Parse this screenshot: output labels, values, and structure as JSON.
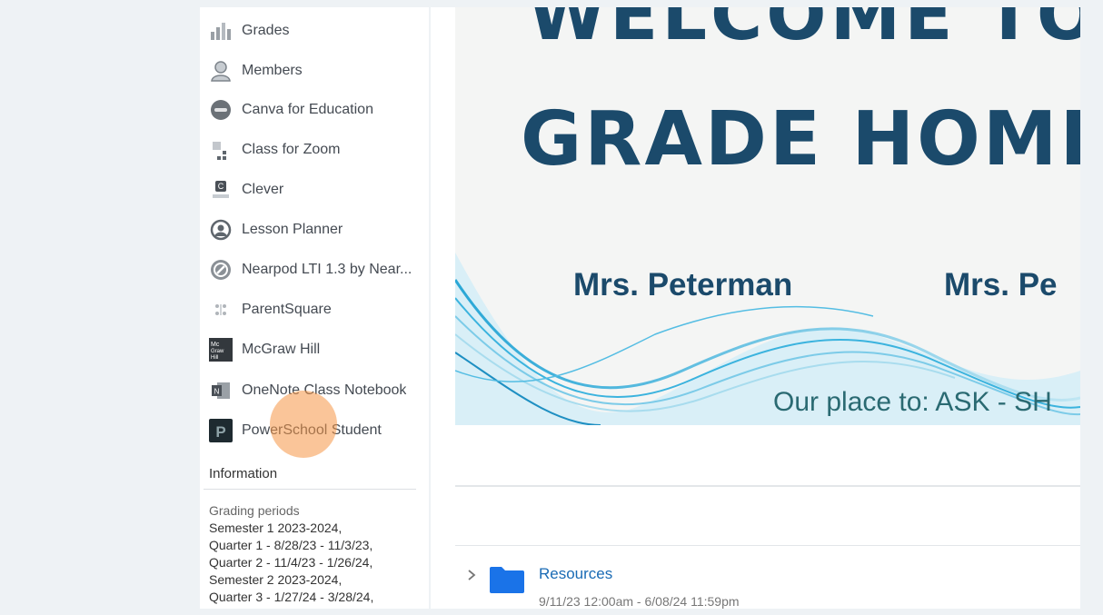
{
  "sidebar": {
    "items": [
      {
        "label": "Grades",
        "icon": "grades-icon"
      },
      {
        "label": "Members",
        "icon": "members-icon"
      },
      {
        "label": "Canva for Education",
        "icon": "canva-icon"
      },
      {
        "label": "Class for Zoom",
        "icon": "zoom-class-icon"
      },
      {
        "label": "Clever",
        "icon": "clever-icon"
      },
      {
        "label": "Lesson Planner",
        "icon": "lesson-planner-icon"
      },
      {
        "label": "Nearpod LTI 1.3 by Near...",
        "icon": "nearpod-icon"
      },
      {
        "label": "ParentSquare",
        "icon": "parentsquare-icon"
      },
      {
        "label": "McGraw Hill",
        "icon": "mcgraw-hill-icon"
      },
      {
        "label": "OneNote Class Notebook",
        "icon": "onenote-icon"
      },
      {
        "label": "PowerSchool Student",
        "icon": "powerschool-icon"
      }
    ],
    "info": {
      "title": "Information",
      "grading_periods_label": "Grading periods",
      "lines": [
        "Semester 1 2023-2024,",
        "Quarter 1 - 8/28/23 - 11/3/23,",
        "Quarter 2 - 11/4/23 - 1/26/24,",
        "Semester 2 2023-2024,",
        "Quarter 3 - 1/27/24 - 3/28/24,"
      ]
    }
  },
  "banner": {
    "line1": "WELCOME TO",
    "line2": "GRADE HOMER",
    "teacher1": "Mrs. Peterman",
    "teacher2": "Mrs. Pe",
    "tagline": "Our place to:  ASK - SH"
  },
  "resources": {
    "name": "Resources",
    "dates": "9/11/23 12:00am - 6/08/24 11:59pm"
  },
  "colors": {
    "accent": "#1a6bb5",
    "banner_text": "#1b4a6b",
    "folder": "#1a73e8",
    "cursor_highlight": "#f59646"
  }
}
